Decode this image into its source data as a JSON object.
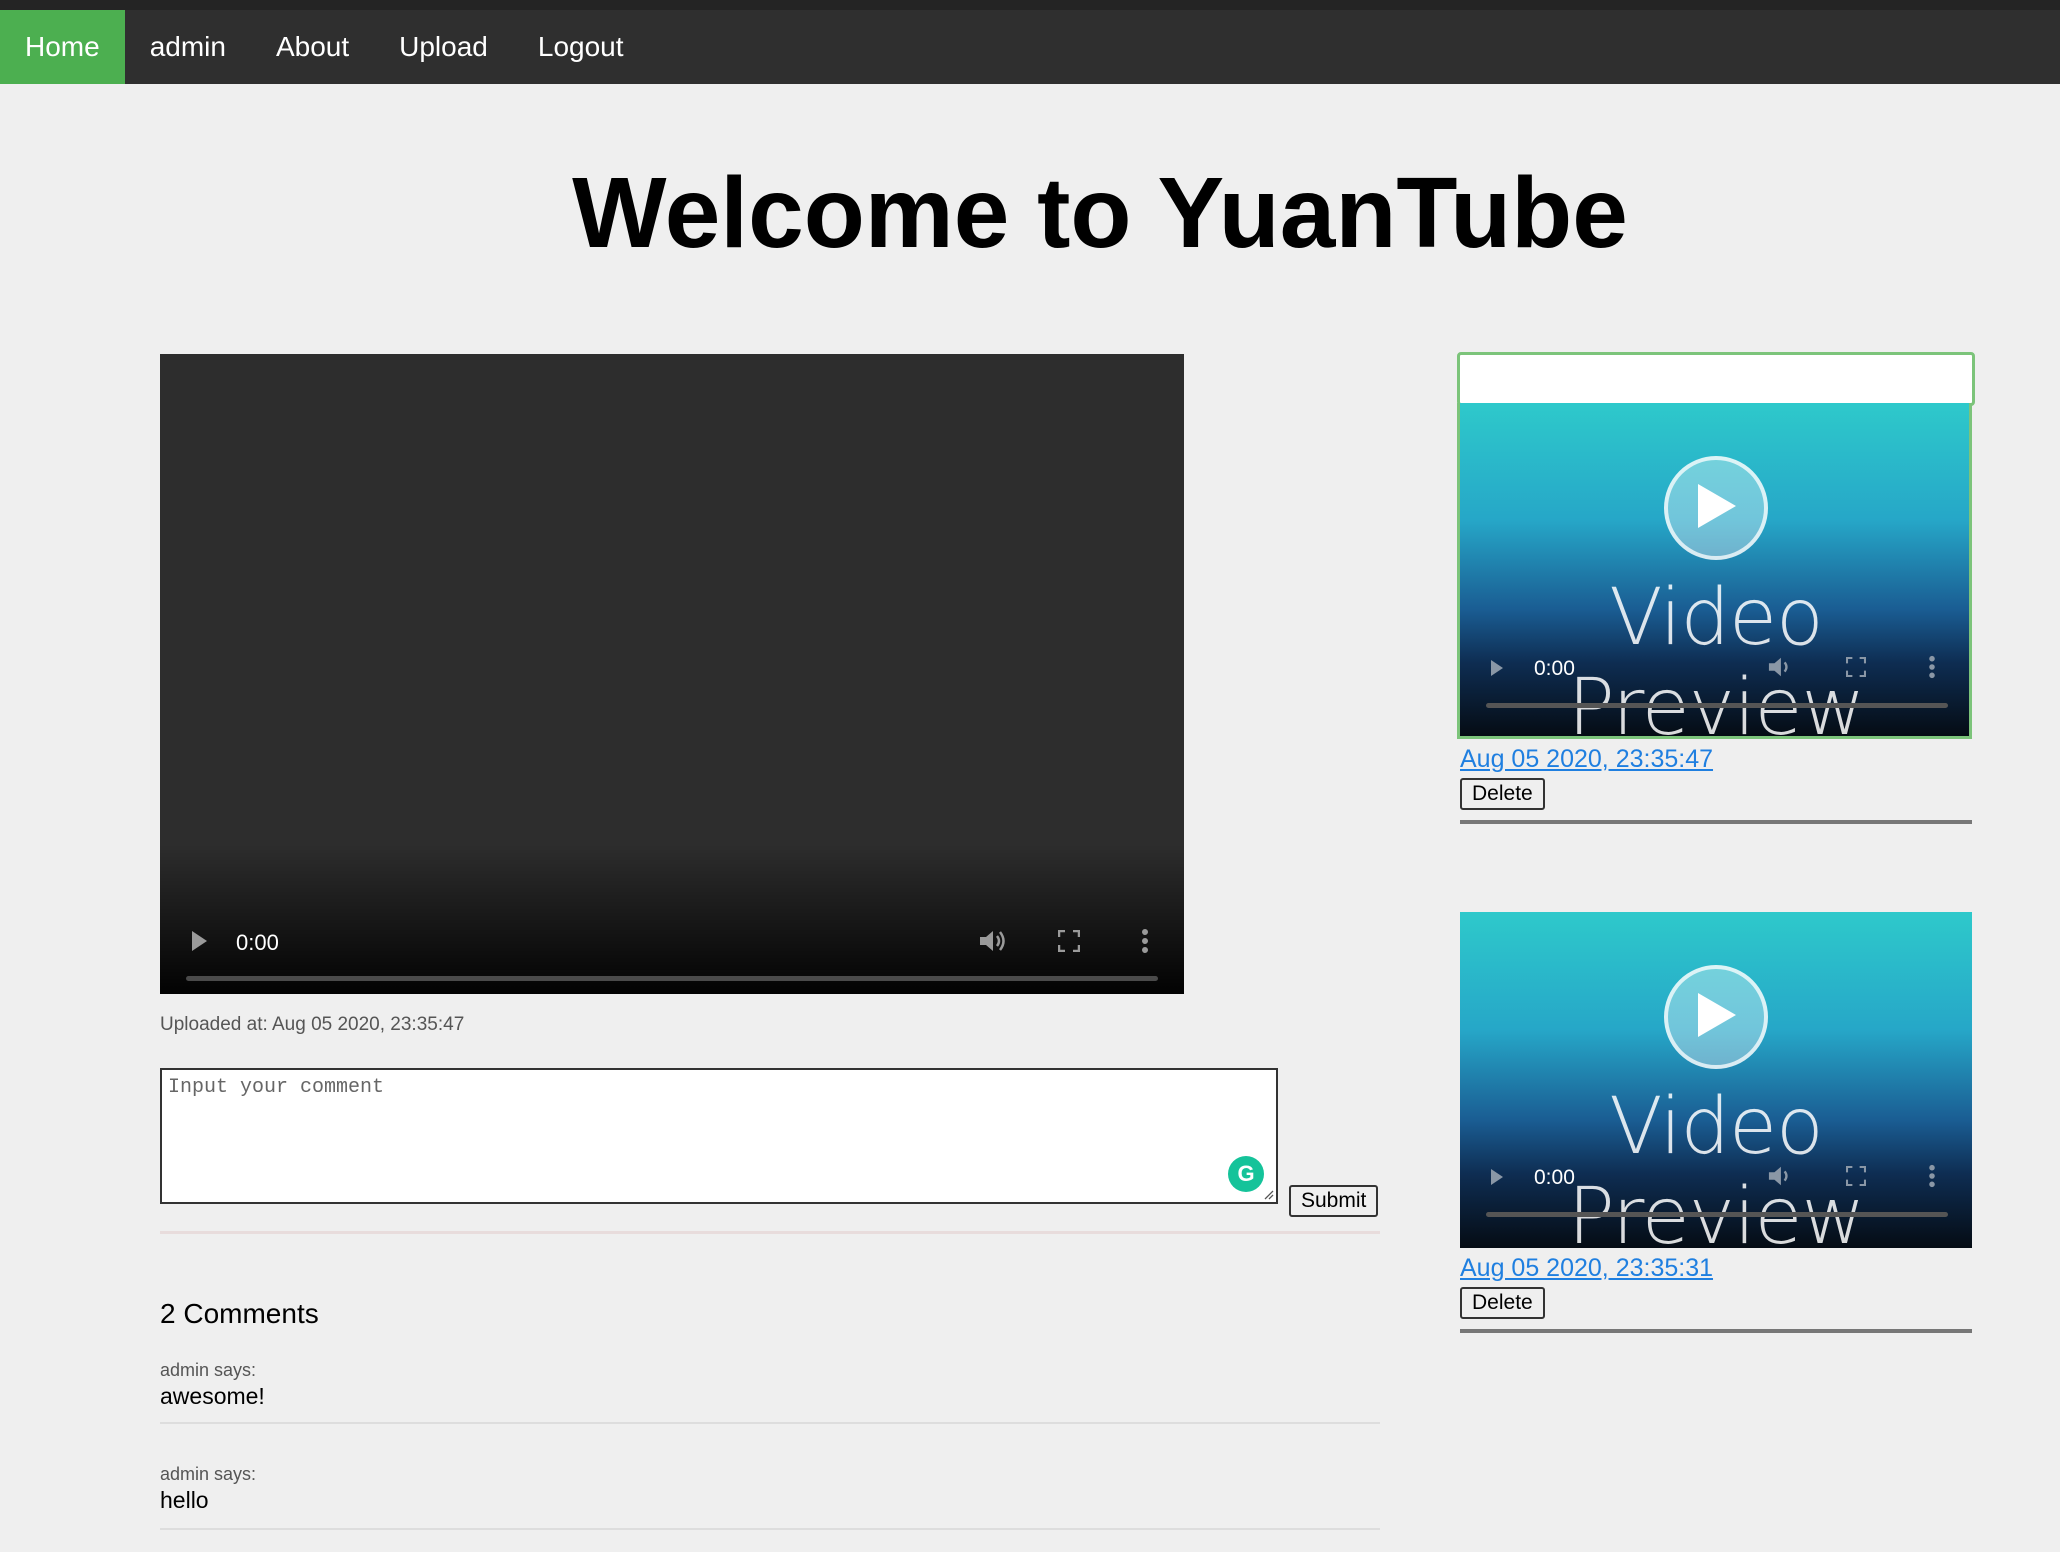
{
  "nav": {
    "items": [
      {
        "label": "Home"
      },
      {
        "label": "admin"
      },
      {
        "label": "About"
      },
      {
        "label": "Upload"
      },
      {
        "label": "Logout"
      }
    ],
    "active_color": "#4caf50"
  },
  "page": {
    "title": "Welcome to YuanTube"
  },
  "player": {
    "time": "0:00"
  },
  "upload_info": "Uploaded at: Aug 05 2020, 23:35:47",
  "comment_form": {
    "placeholder": "Input your comment",
    "submit_label": "Submit",
    "grammarly_letter": "G"
  },
  "comments": {
    "count_label": "2 Comments",
    "items": [
      {
        "author": "admin says:",
        "text": "awesome!"
      },
      {
        "author": "admin says:",
        "text": "hello"
      }
    ]
  },
  "sidebar": {
    "videos": [
      {
        "thumb_text": "Video Preview",
        "time": "0:00",
        "date": "Aug 05 2020, 23:35:47",
        "delete_label": "Delete",
        "selected": true
      },
      {
        "thumb_text": "Video Preview",
        "time": "0:00",
        "date": "Aug 05 2020, 23:35:31",
        "delete_label": "Delete",
        "selected": false
      }
    ]
  }
}
